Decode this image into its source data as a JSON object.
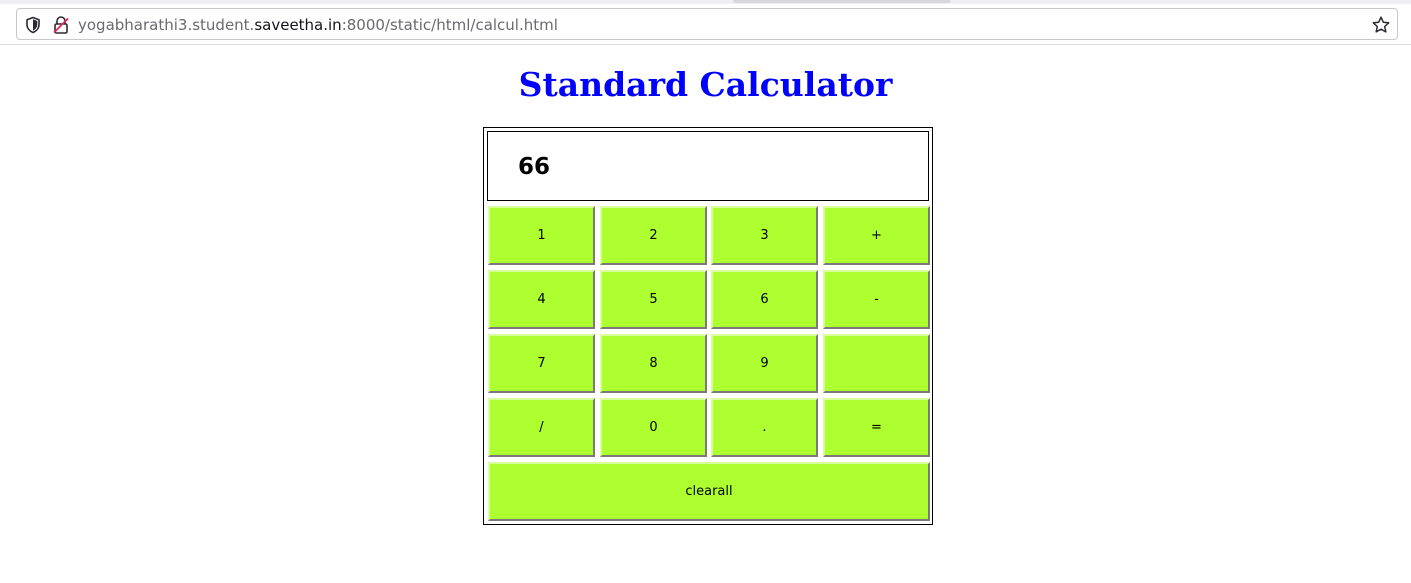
{
  "browser": {
    "url_prefix": "yogabharathi3.student.",
    "url_host": "saveetha.in",
    "url_suffix": ":8000/static/html/calcul.html",
    "icons": [
      "shield-icon",
      "insecure-lock-icon",
      "bookmark-star-icon"
    ]
  },
  "page": {
    "title": "Standard Calculator",
    "title_color": "#0000ff"
  },
  "calculator": {
    "display_value": "66",
    "button_color": "#adff2f",
    "keys": {
      "k1": "1",
      "k2": "2",
      "k3": "3",
      "plus": "+",
      "k4": "4",
      "k5": "5",
      "k6": "6",
      "minus": "-",
      "k7": "7",
      "k8": "8",
      "k9": "9",
      "blank": "",
      "divide": "/",
      "k0": "0",
      "dot": ".",
      "equals": "=",
      "clear": "clearall"
    }
  }
}
